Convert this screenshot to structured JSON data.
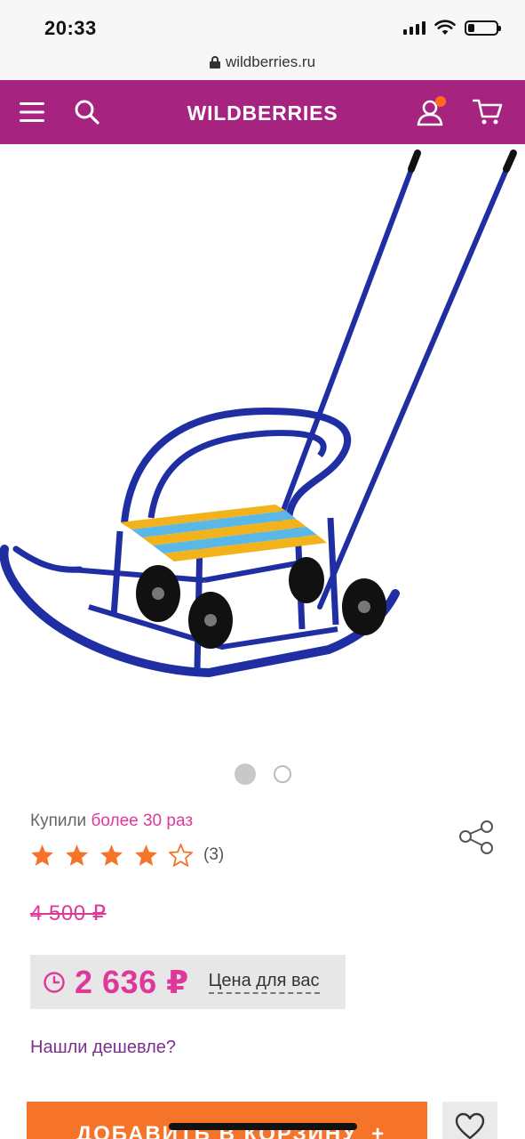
{
  "status_bar": {
    "time": "20:33",
    "battery_level": 0.22
  },
  "browser": {
    "url": "wildberries.ru"
  },
  "header": {
    "title": "WILDBERRIES",
    "brand_color": "#a72380",
    "notification_dot_color": "#ff6a20"
  },
  "gallery": {
    "image_alt": "Санки с колёсами и ручкой",
    "total_images": 2,
    "active_index": 0
  },
  "product": {
    "bought_prefix": "Купили",
    "bought_highlight": "более 30 раз",
    "rating_value": 4,
    "rating_max": 5,
    "reviews_count": "(3)",
    "old_price": "4 500 ₽",
    "price": "2 636 ₽",
    "price_label": "Цена для вас",
    "cheaper_link": "Нашли дешевле?"
  },
  "actions": {
    "add_to_cart": "ДОБАВИТЬ В КОРЗИНУ",
    "add_to_cart_plus": "+",
    "accent_color": "#f6732a"
  },
  "icons": [
    "lock-icon",
    "menu-icon",
    "search-icon",
    "profile-icon",
    "cart-icon",
    "share-icon",
    "star-icon",
    "clock-icon",
    "heart-icon"
  ]
}
